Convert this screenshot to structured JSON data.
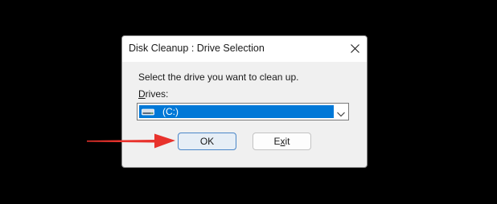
{
  "dialog": {
    "title": "Disk Cleanup : Drive Selection",
    "close_icon": "close-icon",
    "prompt": "Select the drive you want to clean up.",
    "drives_label_mnemonic": "D",
    "drives_label_rest": "rives:",
    "drives_select": {
      "selected_value": "(C:)",
      "icon": "hard-drive-icon",
      "dropdown_icon": "chevron-down-icon"
    },
    "ok_label": "OK",
    "exit_label_mnemonic": "x",
    "exit_label_prefix": "E",
    "exit_label_suffix": "it"
  },
  "annotation": {
    "icon": "red-arrow-icon",
    "color": "#e8322c"
  },
  "colors": {
    "selection": "#0078d7",
    "dialog_bg": "#f0f0f0",
    "desktop_bg": "#000000"
  }
}
